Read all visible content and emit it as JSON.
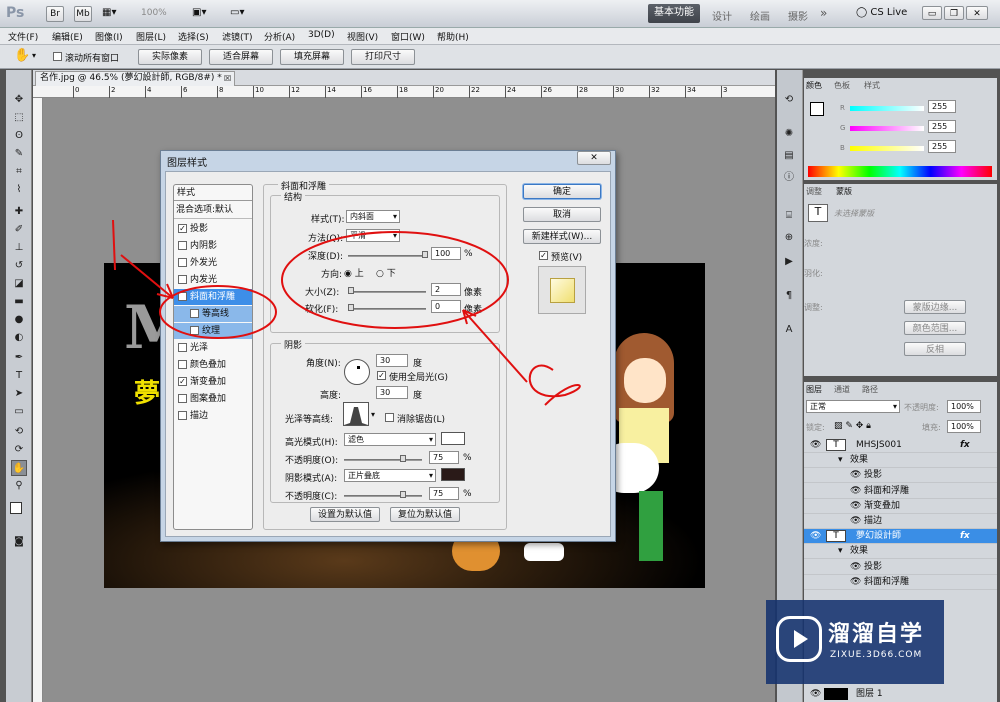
{
  "app": {
    "logo": "Ps",
    "zoom": "100%",
    "workspaces": [
      "基本功能",
      "设计",
      "绘画",
      "摄影"
    ],
    "more": "»",
    "cslive": "CS Live"
  },
  "menu": [
    "文件(F)",
    "编辑(E)",
    "图像(I)",
    "图层(L)",
    "选择(S)",
    "滤镜(T)",
    "分析(A)",
    "3D(D)",
    "视图(V)",
    "窗口(W)",
    "帮助(H)"
  ],
  "options": {
    "scroll_all": "滚动所有窗口",
    "actual_pixels": "实际像素",
    "fit_screen": "适合屏幕",
    "fill_screen": "填充屏幕",
    "print_size": "打印尺寸"
  },
  "doc_tab": "名作.jpg @ 46.5% (夢幻設計師, RGB/8#) *",
  "ruler_ticks": [
    "0",
    "2",
    "4",
    "6",
    "8",
    "10",
    "12",
    "14",
    "16",
    "18",
    "20",
    "22",
    "24",
    "26",
    "28",
    "30",
    "32",
    "34",
    "3"
  ],
  "dialog": {
    "title": "图层样式",
    "close": "✕",
    "styles_header": "样式",
    "blend_options": "混合选项:默认",
    "style_items": [
      {
        "label": "投影",
        "checked": true
      },
      {
        "label": "内阴影",
        "checked": false
      },
      {
        "label": "外发光",
        "checked": false
      },
      {
        "label": "内发光",
        "checked": false
      },
      {
        "label": "斜面和浮雕",
        "checked": true,
        "selected": true
      },
      {
        "label": "等高线",
        "checked": false,
        "sub": true
      },
      {
        "label": "纹理",
        "checked": false,
        "sub": true
      },
      {
        "label": "光泽",
        "checked": false
      },
      {
        "label": "颜色叠加",
        "checked": false
      },
      {
        "label": "渐变叠加",
        "checked": true
      },
      {
        "label": "图案叠加",
        "checked": false
      },
      {
        "label": "描边",
        "checked": false
      }
    ],
    "section_title": "斜面和浮雕",
    "structure_title": "结构",
    "style_label": "样式(T):",
    "style_value": "内斜面",
    "method_label": "方法(Q):",
    "method_value": "平滑",
    "depth_label": "深度(D):",
    "depth_value": "100",
    "depth_unit": "%",
    "depth_level": 1.0,
    "direction_label": "方向:",
    "dir_up": "上",
    "dir_down": "下",
    "size_label": "大小(Z):",
    "size_value": "2",
    "size_unit": "像素",
    "size_level": 0.02,
    "soften_label": "软化(F):",
    "soften_value": "0",
    "soften_unit": "像素",
    "soften_level": 0.0,
    "shading_title": "阴影",
    "angle_label": "角度(N):",
    "angle_value": "30",
    "angle_unit": "度",
    "global_light": "使用全局光(G)",
    "altitude_label": "高度:",
    "altitude_value": "30",
    "altitude_unit": "度",
    "gloss_label": "光泽等高线:",
    "antialias": "消除锯齿(L)",
    "hl_mode_label": "高光模式(H):",
    "hl_mode_value": "滤色",
    "hl_color": "#ffffff",
    "hl_opacity_label": "不透明度(O):",
    "hl_opacity_value": "75",
    "hl_opacity_unit": "%",
    "hl_opacity_level": 0.75,
    "sh_mode_label": "阴影模式(A):",
    "sh_mode_value": "正片叠底",
    "sh_color": "#2a1a18",
    "sh_opacity_label": "不透明度(C):",
    "sh_opacity_value": "75",
    "sh_opacity_unit": "%",
    "sh_opacity_level": 0.75,
    "make_default": "设置为默认值",
    "reset_default": "复位为默认值",
    "ok": "确定",
    "cancel": "取消",
    "new_style": "新建样式(W)...",
    "preview": "预览(V)"
  },
  "annotation": {
    "one": "1",
    "two": "2",
    "color": "#e01010"
  },
  "canvas_text": {
    "letter": "M",
    "yellow": "夢"
  },
  "color_panel": {
    "tabs": [
      "颜色",
      "色板",
      "样式"
    ],
    "r": "255",
    "g": "255",
    "b": "255",
    "r_label": "R",
    "g_label": "G",
    "b_label": "B"
  },
  "adj_panel": {
    "tabs": [
      "调整",
      "蒙版"
    ],
    "placeholder": "未选择蒙版",
    "density": "浓度:",
    "feather": "羽化:",
    "refine": "调整:",
    "edge_btn": "蒙版边缘...",
    "range_btn": "颜色范围...",
    "invert_btn": "反相"
  },
  "layers_panel": {
    "tabs": [
      "图层",
      "通道",
      "路径"
    ],
    "blend": "正常",
    "opacity_label": "不透明度:",
    "opacity": "100%",
    "lock_label": "锁定:",
    "fill_label": "填充:",
    "fill": "100%",
    "rows": [
      {
        "name": "MHSJS001",
        "type": "T",
        "fx": "fx"
      },
      {
        "name": "效果",
        "indent": 1
      },
      {
        "name": "投影",
        "indent": 2
      },
      {
        "name": "斜面和浮雕",
        "indent": 2
      },
      {
        "name": "渐变叠加",
        "indent": 2
      },
      {
        "name": "描边",
        "indent": 2
      },
      {
        "name": "夢幻設計師",
        "type": "T",
        "fx": "fx",
        "selected": true
      },
      {
        "name": "效果",
        "indent": 1
      },
      {
        "name": "投影",
        "indent": 2
      },
      {
        "name": "斜面和浮雕",
        "indent": 2
      }
    ],
    "bottom_layer": "图层 1"
  },
  "watermark": {
    "brand": "溜溜自学",
    "url": "ZIXUE.3D66.COM"
  }
}
